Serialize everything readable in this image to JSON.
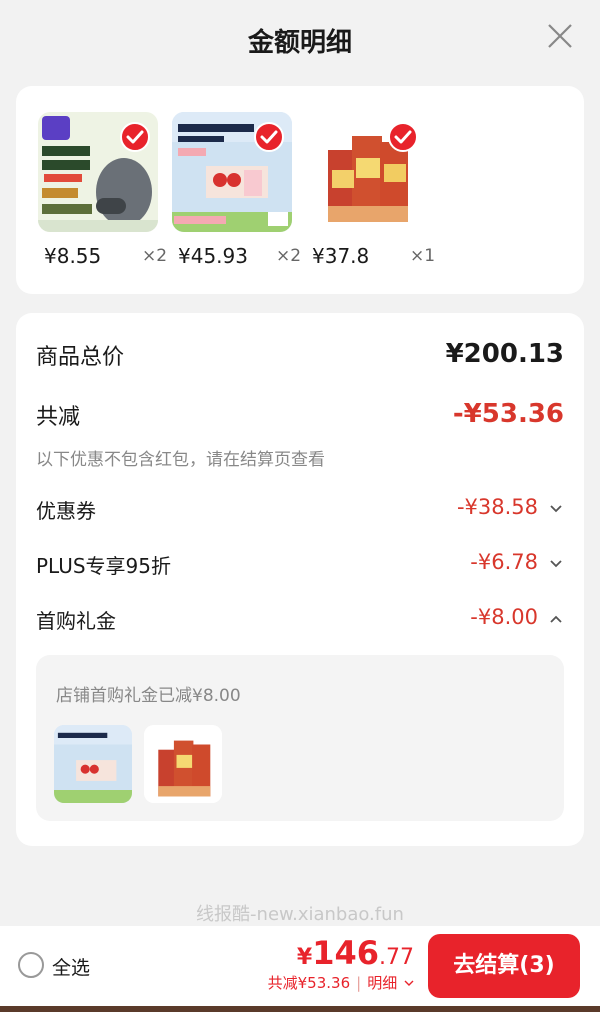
{
  "header": {
    "title": "金额明细"
  },
  "products": [
    {
      "price": "¥8.55",
      "qty": "×2",
      "selected": true
    },
    {
      "price": "¥45.93",
      "qty": "×2",
      "selected": true
    },
    {
      "price": "¥37.8",
      "qty": "×1",
      "selected": true
    }
  ],
  "summary": {
    "total_label": "商品总价",
    "total_value": "¥200.13",
    "discount_label": "共减",
    "discount_value": "-¥53.36",
    "note": "以下优惠不包含红包，请在结算页查看",
    "items": [
      {
        "label": "优惠券",
        "value": "-¥38.58",
        "chevron": "down"
      },
      {
        "label": "PLUS专享95折",
        "value": "-¥6.78",
        "chevron": "down"
      },
      {
        "label": "首购礼金",
        "value": "-¥8.00",
        "chevron": "up"
      }
    ],
    "gift_caption": "店铺首购礼金已减¥8.00"
  },
  "watermark": "线报酷-new.xianbao.fun",
  "footer": {
    "select_all": "全选",
    "currency": "¥",
    "total_int": "146",
    "total_dec": ".77",
    "saved": "共减¥53.36",
    "detail": "明细",
    "checkout": "去结算(3)"
  },
  "colors": {
    "accent": "#e8232b",
    "discount": "#d8372c"
  }
}
